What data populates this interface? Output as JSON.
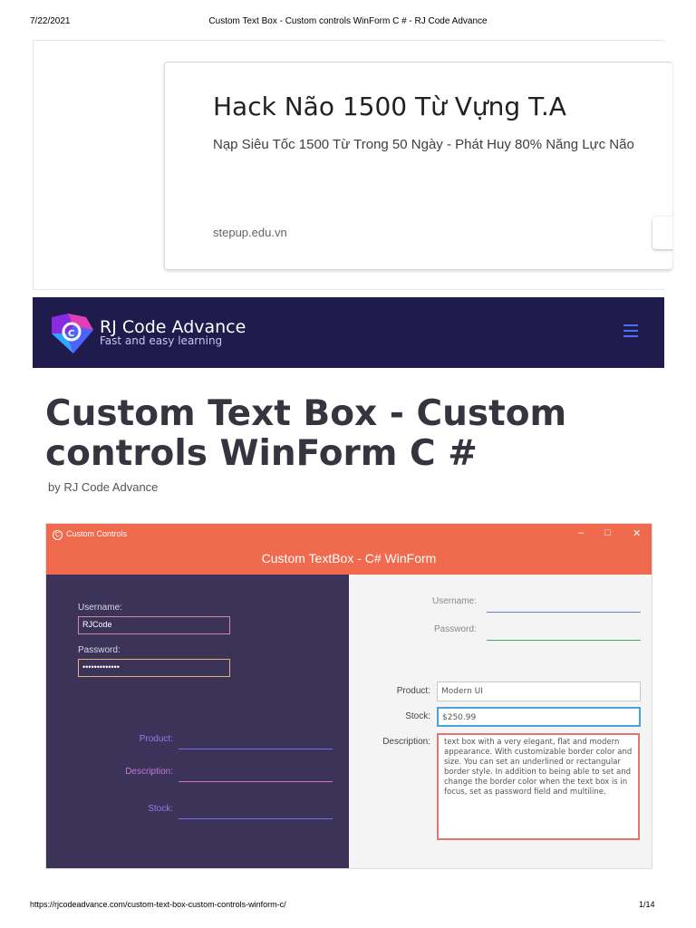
{
  "header": {
    "date": "7/22/2021",
    "title": "Custom Text Box - Custom controls WinForm C # - RJ Code Advance"
  },
  "ad": {
    "title": "Hack Não 1500 Từ Vựng T.A",
    "subtitle": "Nạp Siêu Tốc 1500 Từ Trong 50 Ngày - Phát Huy 80% Năng Lực Não",
    "url": "stepup.edu.vn"
  },
  "nav": {
    "brand_name": "RJ Code Advance",
    "brand_tagline": "Fast and easy learning",
    "menu_icon": "hamburger-menu-icon",
    "background": "#1f1b4d",
    "accent": "#4f6ef7"
  },
  "article": {
    "title": "Custom Text Box - Custom controls WinForm C #",
    "byline": "by RJ Code Advance"
  },
  "screenshot": {
    "app_title": "Custom Controls",
    "app_icon": "C",
    "heading": "Custom TextBox - C# WinForm",
    "titlebar_color": "#f06a4e",
    "window_buttons": {
      "minimize": "–",
      "maximize": "□",
      "close": "✕"
    },
    "left": {
      "background": "#3c3359",
      "username_label": "Username:",
      "username_value": "RJCode",
      "password_label": "Password:",
      "password_value": "•••••••••••••",
      "product_label": "Product:",
      "description_label": "Description:",
      "stock_label": "Stock:"
    },
    "right": {
      "username_label": "Username:",
      "password_label": "Password:",
      "product_label": "Product:",
      "product_value": "Modern UI",
      "stock_label": "Stock:",
      "stock_value": "$250.99",
      "description_label": "Description:",
      "description_value": "text box with a very elegant, flat and modern appearance. With customizable border color and size. You can set an underlined or rectangular border style. In addition to being able to set and change the border color when the text box is in focus, set as password field and multiline."
    }
  },
  "footer": {
    "url": "https://rjcodeadvance.com/custom-text-box-custom-controls-winform-c/",
    "page": "1/14"
  }
}
